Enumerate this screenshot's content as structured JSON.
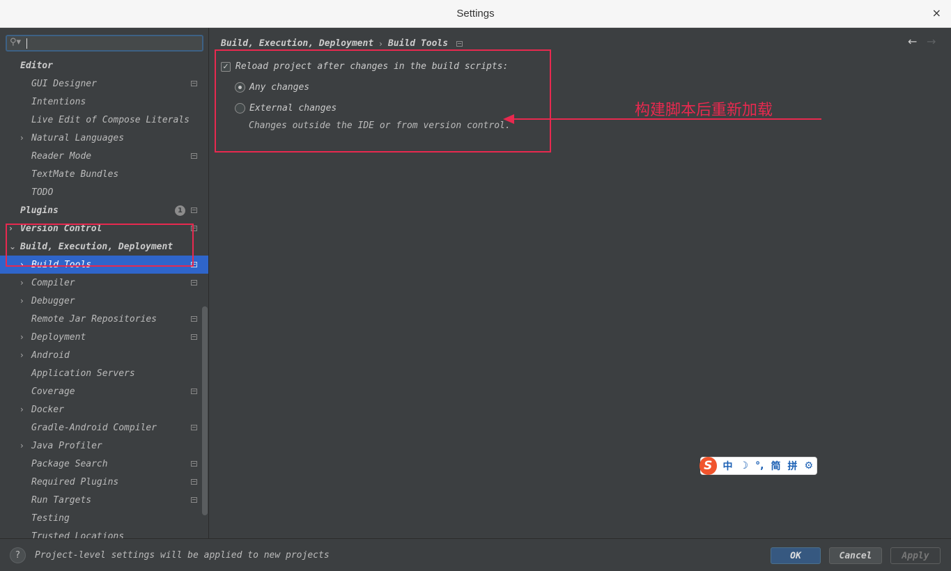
{
  "window": {
    "title": "Settings",
    "close_glyph": "×"
  },
  "search": {
    "value": "",
    "placeholder": ""
  },
  "tree": {
    "items": [
      {
        "label": "Editor",
        "level": 0,
        "bold": true,
        "chevron": "",
        "project": false
      },
      {
        "label": "GUI Designer",
        "level": 1,
        "bold": false,
        "chevron": "",
        "project": true
      },
      {
        "label": "Intentions",
        "level": 1,
        "bold": false,
        "chevron": "",
        "project": false
      },
      {
        "label": "Live Edit of Compose Literals",
        "level": 1,
        "bold": false,
        "chevron": "",
        "project": false
      },
      {
        "label": "Natural Languages",
        "level": 1,
        "bold": false,
        "chevron": "›",
        "project": false
      },
      {
        "label": "Reader Mode",
        "level": 1,
        "bold": false,
        "chevron": "",
        "project": true
      },
      {
        "label": "TextMate Bundles",
        "level": 1,
        "bold": false,
        "chevron": "",
        "project": false
      },
      {
        "label": "TODO",
        "level": 1,
        "bold": false,
        "chevron": "",
        "project": false
      },
      {
        "label": "Plugins",
        "level": 0,
        "bold": true,
        "chevron": "",
        "project": true,
        "badge": "1"
      },
      {
        "label": "Version Control",
        "level": 0,
        "bold": true,
        "chevron": "›",
        "project": true
      },
      {
        "label": "Build, Execution, Deployment",
        "level": 0,
        "bold": true,
        "chevron": "⌄",
        "project": false
      },
      {
        "label": "Build Tools",
        "level": 1,
        "bold": false,
        "chevron": "›",
        "project": true,
        "selected": true
      },
      {
        "label": "Compiler",
        "level": 1,
        "bold": false,
        "chevron": "›",
        "project": true
      },
      {
        "label": "Debugger",
        "level": 1,
        "bold": false,
        "chevron": "›",
        "project": false
      },
      {
        "label": "Remote Jar Repositories",
        "level": 1,
        "bold": false,
        "chevron": "",
        "project": true
      },
      {
        "label": "Deployment",
        "level": 1,
        "bold": false,
        "chevron": "›",
        "project": true
      },
      {
        "label": "Android",
        "level": 1,
        "bold": false,
        "chevron": "›",
        "project": false
      },
      {
        "label": "Application Servers",
        "level": 1,
        "bold": false,
        "chevron": "",
        "project": false
      },
      {
        "label": "Coverage",
        "level": 1,
        "bold": false,
        "chevron": "",
        "project": true
      },
      {
        "label": "Docker",
        "level": 1,
        "bold": false,
        "chevron": "›",
        "project": false
      },
      {
        "label": "Gradle-Android Compiler",
        "level": 1,
        "bold": false,
        "chevron": "",
        "project": true
      },
      {
        "label": "Java Profiler",
        "level": 1,
        "bold": false,
        "chevron": "›",
        "project": false
      },
      {
        "label": "Package Search",
        "level": 1,
        "bold": false,
        "chevron": "",
        "project": true
      },
      {
        "label": "Required Plugins",
        "level": 1,
        "bold": false,
        "chevron": "",
        "project": true
      },
      {
        "label": "Run Targets",
        "level": 1,
        "bold": false,
        "chevron": "",
        "project": true
      },
      {
        "label": "Testing",
        "level": 1,
        "bold": false,
        "chevron": "",
        "project": false
      },
      {
        "label": "Trusted Locations",
        "level": 1,
        "bold": false,
        "chevron": "",
        "project": false
      }
    ]
  },
  "main": {
    "breadcrumb": {
      "parent": "Build, Execution, Deployment",
      "separator": "›",
      "current": "Build Tools"
    },
    "nav": {
      "back": "←",
      "forward": "→"
    },
    "reload_checkbox": {
      "label": "Reload project after changes in the build scripts:",
      "checked": true,
      "glyph": "✓"
    },
    "radio_any": {
      "label": "Any changes",
      "selected": true
    },
    "radio_external": {
      "label": "External changes",
      "selected": false
    },
    "external_hint": "Changes outside the IDE or from version control.",
    "annotation_text": "构建脚本后重新加载",
    "annotation_color": "#e8294f"
  },
  "ime": {
    "logo": "S",
    "chars": [
      "中",
      "☽",
      "°,",
      "简",
      "拼",
      "⚙"
    ]
  },
  "footer": {
    "help": "?",
    "note": "Project-level settings will be applied to new projects",
    "ok": "OK",
    "cancel": "Cancel",
    "apply": "Apply"
  },
  "colors": {
    "accent": "#2f65ca",
    "background": "#3c3f41",
    "ok_button": "#365880"
  }
}
